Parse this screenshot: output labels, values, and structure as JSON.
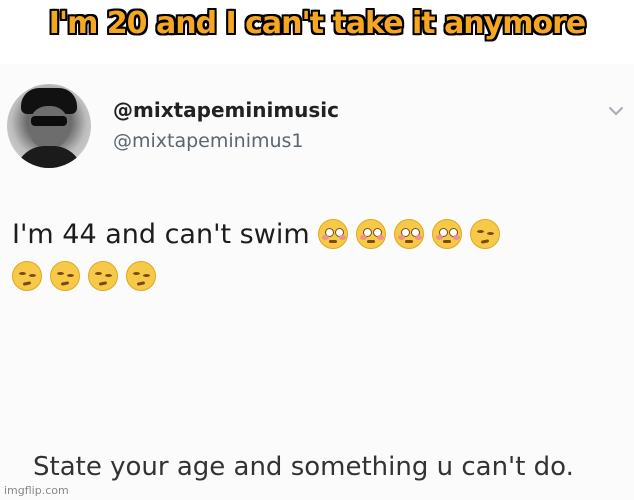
{
  "caption": "I'm 20 and I can't take it anymore",
  "tweet": {
    "display_name": "@mixtapeminimusic",
    "handle": "@mixtapeminimus1",
    "text": "I'm 44 and can't swim",
    "emojis": [
      "flushed-face",
      "flushed-face",
      "flushed-face",
      "flushed-face",
      "woozy-face",
      "woozy-face",
      "woozy-face",
      "woozy-face",
      "woozy-face"
    ]
  },
  "quoted_text": "State your age and something u can't do.",
  "watermark": "imgflip.com"
}
